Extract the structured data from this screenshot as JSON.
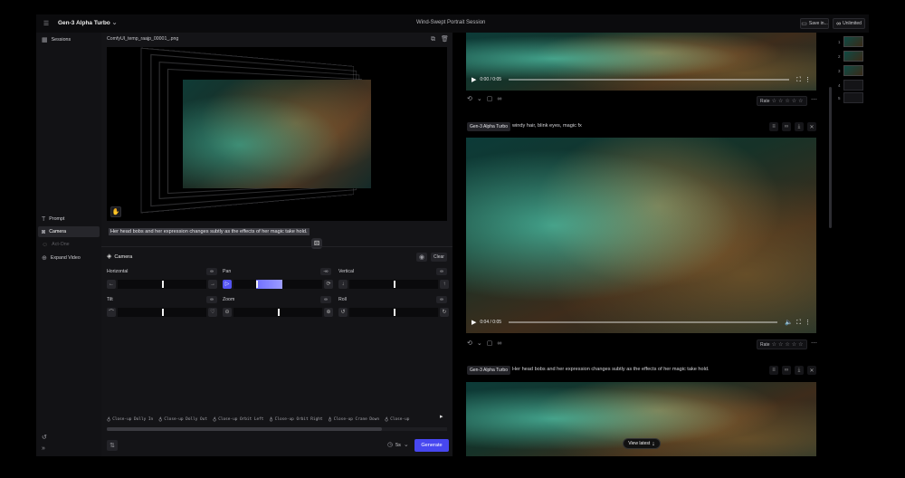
{
  "app": {
    "model_name": "Gen-3 Alpha Turbo",
    "session_title": "Wind-Swept Portrait Session",
    "save_label": "Save in...",
    "plan_label": "Unlimited"
  },
  "sidebar": {
    "items": [
      {
        "label": "Sessions",
        "icon": "grid-icon"
      },
      {
        "label": "Prompt",
        "icon": "text-icon"
      },
      {
        "label": "Camera",
        "icon": "camera-icon"
      },
      {
        "label": "Act-One",
        "icon": "person-icon"
      },
      {
        "label": "Expand Video",
        "icon": "expand-icon"
      }
    ]
  },
  "editor": {
    "file_name": "ComfyUI_temp_raajp_00001_.png",
    "prompt_text": "Her head bobs and her expression changes subtly as the effects of her magic take hold.",
    "camera_title": "Camera",
    "clear_label": "Clear",
    "controls": [
      {
        "label": "Horizontal",
        "link": "∞",
        "value": 0.5
      },
      {
        "label": "Pan",
        "link": "-∞",
        "value": 0.5
      },
      {
        "label": "Vertical",
        "link": "∞",
        "value": 0.5
      },
      {
        "label": "Tilt",
        "link": "∞",
        "value": 0.5
      },
      {
        "label": "Zoom",
        "link": "∞",
        "value": 0.5
      },
      {
        "label": "Roll",
        "link": "∞",
        "value": 0.5
      }
    ],
    "presets": [
      "Close-up Dolly In",
      "Close-up Dolly Out",
      "Close-up Orbit Left",
      "Close-up Orbit Right",
      "Close-up Crane Down",
      "Close-up"
    ],
    "duration": "5s",
    "generate_label": "Generate"
  },
  "feed": {
    "card1": {
      "time": "0:00 / 0:05",
      "rate_label": "Rate"
    },
    "card2": {
      "model_tag": "Gen-3 Alpha Turbo",
      "prompt": "windy hair, blink eyes, magic fx",
      "time": "0:04 / 0:05",
      "rate_label": "Rate"
    },
    "card3": {
      "model_tag": "Gen-3 Alpha Turbo",
      "prompt": "Her head bobs and her expression changes subtly as the effects of her magic take hold."
    },
    "view_latest_label": "View latest"
  },
  "rail": {
    "numbers": [
      "1",
      "2",
      "3",
      "4",
      "5"
    ]
  },
  "colors": {
    "accent": "#4747f0",
    "background": "#000000",
    "panel": "#141417"
  }
}
